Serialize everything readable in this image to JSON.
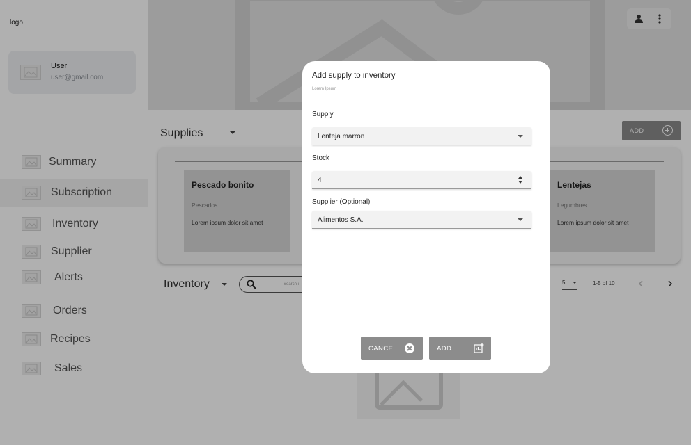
{
  "sidebar": {
    "logo": "logo",
    "user": {
      "name": "User",
      "email": "user@gmail.com"
    },
    "items": [
      {
        "label": "Summary",
        "icon": "image-placeholder-icon"
      },
      {
        "label": "Subscription",
        "icon": "image-placeholder-icon",
        "active": true
      },
      {
        "label": "Inventory",
        "icon": "image-placeholder-icon"
      },
      {
        "label": "Supplier",
        "icon": "image-placeholder-icon"
      },
      {
        "label": "Alerts",
        "icon": "image-placeholder-icon"
      },
      {
        "label": "Orders",
        "icon": "image-placeholder-icon"
      },
      {
        "label": "Recipes",
        "icon": "image-placeholder-icon"
      },
      {
        "label": "Sales",
        "icon": "image-placeholder-icon"
      }
    ]
  },
  "header": {
    "icons": [
      "person-icon",
      "more-vert-icon"
    ]
  },
  "supplies": {
    "title": "Supplies",
    "add_label": "ADD",
    "cards": [
      {
        "title": "Pescado bonito",
        "category": "Pescados",
        "desc": "Lorem ipsum dolor sit amet"
      },
      {
        "title": "Lentejas",
        "category": "Legumbres",
        "desc": "Lorem ipsum dolor sit amet"
      }
    ]
  },
  "inventory": {
    "title": "Inventory",
    "search_placeholder": "Search i",
    "rows_per_page": "5",
    "range": "1-5 of 10"
  },
  "dialog": {
    "title": "Add supply to inventory",
    "subtitle": "Lorem Ipsum",
    "supply_label": "Supply",
    "supply_value": "Lenteja marron",
    "stock_label": "Stock",
    "stock_value": "4",
    "supplier_label": "Supplier (Optional)",
    "supplier_value": "Alimentos S.A.",
    "cancel_label": "CANCEL",
    "add_label": "ADD"
  },
  "colors": {
    "overlay": "#000000",
    "button": "#8c8c8c",
    "sidebar_active": "#f1f1f1"
  }
}
